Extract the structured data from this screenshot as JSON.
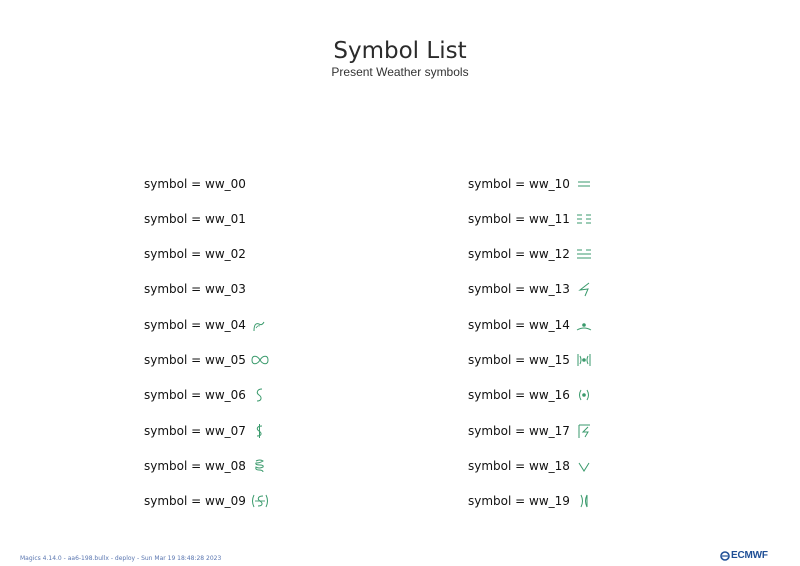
{
  "header": {
    "title": "Symbol List",
    "subtitle": "Present Weather symbols"
  },
  "symbol_color": "#3a9a6c",
  "columns": [
    {
      "items": [
        {
          "label": "symbol = ww_00",
          "icon": "ww-00-icon"
        },
        {
          "label": "symbol = ww_01",
          "icon": "ww-01-icon"
        },
        {
          "label": "symbol = ww_02",
          "icon": "ww-02-icon"
        },
        {
          "label": "symbol = ww_03",
          "icon": "ww-03-icon"
        },
        {
          "label": "symbol = ww_04",
          "icon": "ww-04-smoke-icon"
        },
        {
          "label": "symbol = ww_05",
          "icon": "ww-05-haze-icon"
        },
        {
          "label": "symbol = ww_06",
          "icon": "ww-06-dust-icon"
        },
        {
          "label": "symbol = ww_07",
          "icon": "ww-07-dust-raised-icon"
        },
        {
          "label": "symbol = ww_08",
          "icon": "ww-08-dust-whirl-icon"
        },
        {
          "label": "symbol = ww_09",
          "icon": "ww-09-duststorm-icon"
        }
      ]
    },
    {
      "items": [
        {
          "label": "symbol = ww_10",
          "icon": "ww-10-mist-icon"
        },
        {
          "label": "symbol = ww_11",
          "icon": "ww-11-shallow-fog-patches-icon"
        },
        {
          "label": "symbol = ww_12",
          "icon": "ww-12-shallow-fog-continuous-icon"
        },
        {
          "label": "symbol = ww_13",
          "icon": "ww-13-lightning-icon"
        },
        {
          "label": "symbol = ww_14",
          "icon": "ww-14-precip-not-reaching-icon"
        },
        {
          "label": "symbol = ww_15",
          "icon": "ww-15-precip-distant-icon"
        },
        {
          "label": "symbol = ww_16",
          "icon": "ww-16-precip-near-icon"
        },
        {
          "label": "symbol = ww_17",
          "icon": "ww-17-thunderstorm-icon"
        },
        {
          "label": "symbol = ww_18",
          "icon": "ww-18-squalls-icon"
        },
        {
          "label": "symbol = ww_19",
          "icon": "ww-19-funnel-cloud-icon"
        }
      ]
    }
  ],
  "footer": {
    "text": "Magics 4.14.0 - aa6-198.bullx - deploy - Sun Mar 19 18:48:28 2023"
  },
  "logo": {
    "text": "ECMWF",
    "icon": "ecmwf-logo-icon",
    "color": "#1f4f96"
  }
}
